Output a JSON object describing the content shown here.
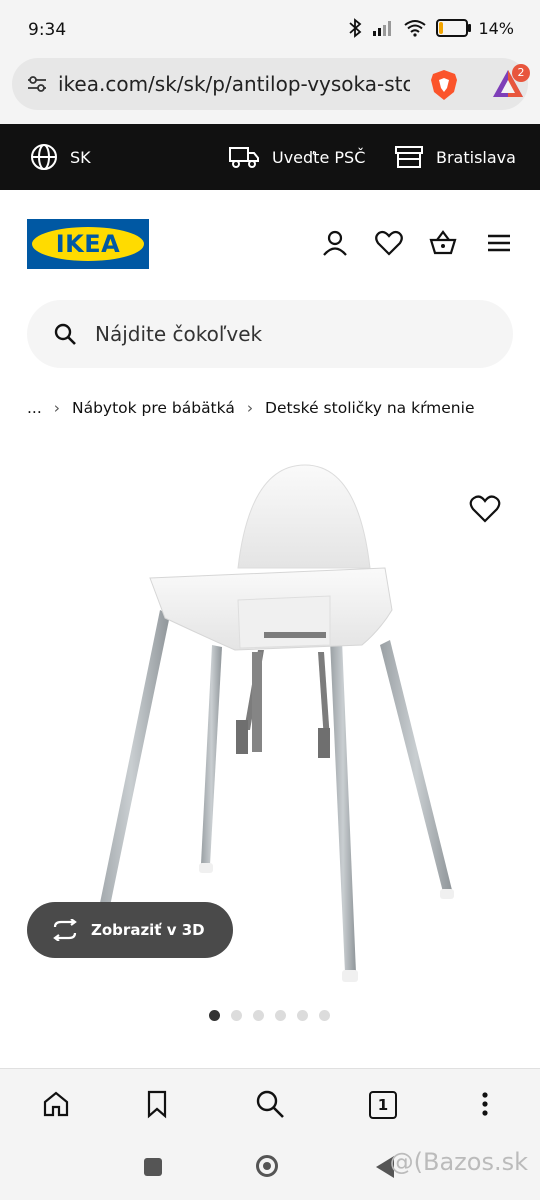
{
  "status_bar": {
    "time": "9:34",
    "battery": "14%",
    "battery_level": 0.14
  },
  "browser": {
    "url": "ikea.com/sk/sk/p/antilop-vysoka-sto",
    "rewards_badge": "2",
    "tabs_count": "1"
  },
  "topbar": {
    "language": "SK",
    "delivery": "Uveďte PSČ",
    "store": "Bratislava"
  },
  "header": {
    "logo_text": "IKEA"
  },
  "search": {
    "placeholder": "Nájdite čokoľvek"
  },
  "breadcrumb": [
    "...",
    "Nábytok pre bábätká",
    "Detské stoličky na kŕmenie"
  ],
  "product": {
    "view3d_label": "Zobraziť v 3D",
    "gallery_dots": 6,
    "active_dot": 0
  },
  "watermark": "@(Bazos.sk",
  "colors": {
    "ikea_blue": "#0058a3",
    "ikea_yellow": "#ffdb00",
    "topbar": "#111111",
    "view3d_button": "#4a4a4a"
  },
  "icons": [
    "globe-icon",
    "truck-icon",
    "store-icon",
    "user-icon",
    "heart-icon",
    "basket-icon",
    "menu-icon",
    "search-icon",
    "favorite-icon",
    "rotate-3d-icon",
    "home-icon",
    "bookmark-icon",
    "tabs-icon",
    "more-icon"
  ]
}
